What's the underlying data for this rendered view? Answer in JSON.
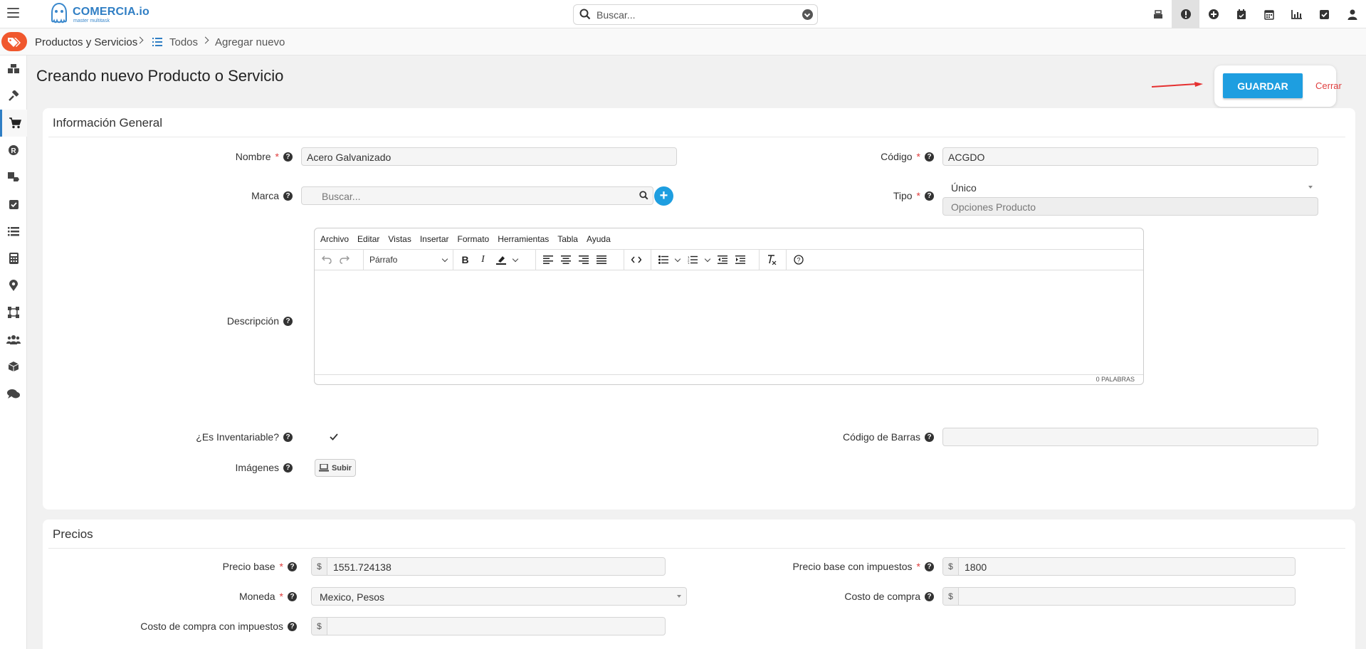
{
  "app": {
    "logo_name": "COMERCIA.io",
    "logo_tagline": "master multitask"
  },
  "search": {
    "placeholder": "Buscar..."
  },
  "breadcrumb": [
    "Productos y Servicios",
    "Todos",
    "Agregar nuevo"
  ],
  "page": {
    "title": "Creando nuevo Producto o Servicio",
    "save_label": "GUARDAR",
    "close_label": "Cerrar"
  },
  "general": {
    "title": "Información General",
    "nombre_label": "Nombre",
    "nombre_value": "Acero Galvanizado",
    "codigo_label": "Código",
    "codigo_value": "ACGDO",
    "marca_label": "Marca",
    "marca_placeholder": "Buscar...",
    "tipo_label": "Tipo",
    "tipo_value": "Único",
    "tipo_options_placeholder": "Opciones Producto",
    "descripcion_label": "Descripción",
    "inventariable_label": "¿Es Inventariable?",
    "inventariable_checked": true,
    "barras_label": "Código de Barras",
    "barras_value": "",
    "imagenes_label": "Imágenes",
    "upload_label": "Subir"
  },
  "editor": {
    "menus": [
      "Archivo",
      "Editar",
      "Vistas",
      "Insertar",
      "Formato",
      "Herramientas",
      "Tabla",
      "Ayuda"
    ],
    "block_format": "Párrafo",
    "word_count": "0 PALABRAS"
  },
  "prices": {
    "title": "Precios",
    "base_label": "Precio base",
    "base_value": "1551.724138",
    "base_tax_label": "Precio base con impuestos",
    "base_tax_value": "1800",
    "moneda_label": "Moneda",
    "moneda_value": "Mexico, Pesos",
    "costo_label": "Costo de compra",
    "costo_value": "",
    "costo_tax_label": "Costo de compra con impuestos",
    "costo_tax_value": "",
    "currency_symbol": "$"
  },
  "colors": {
    "accent": "#1e9ee0",
    "brand": "#2f7ec4",
    "badge": "#f0572d",
    "required": "#e03b3b"
  },
  "icons": {
    "topbar": [
      "cash-register-icon",
      "alert-icon",
      "plus-circle-icon",
      "calendar-check-icon",
      "calendar-icon",
      "chart-icon",
      "check-square-icon",
      "user-icon"
    ],
    "sidebar": [
      "boxes-icon",
      "hammer-icon",
      "cart-icon",
      "registered-icon",
      "box-tag-icon",
      "check-square-icon",
      "list-icon",
      "calculator-icon",
      "map-marker-icon",
      "vector-square-icon",
      "users-icon",
      "cube-icon",
      "comments-icon"
    ]
  }
}
